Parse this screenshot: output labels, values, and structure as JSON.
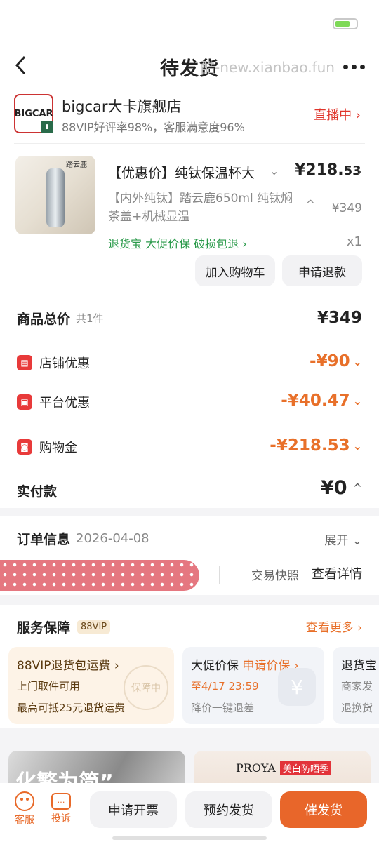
{
  "header": {
    "title": "待发货",
    "watermark": "酷-new.xianbao.fun"
  },
  "shop": {
    "logo": "BIGCAR",
    "name": "bigcar大卡旗舰店",
    "stats": "88VIP好评率98%，客服满意度96%",
    "live": "直播中 ›"
  },
  "product": {
    "image_brand": "踏云鹿",
    "name": "【优惠价】纯钛保温杯大",
    "price_int": "¥218.",
    "price_dec": "53",
    "desc": "【内外纯钛】踏云鹿650ml 纯钛焖茶盖+机械显温",
    "orig_price": "¥349",
    "guarantees": "退货宝  大促价保  破损包退 ›",
    "qty": "x1",
    "btn_cart": "加入购物车",
    "btn_refund": "申请退款"
  },
  "summary": {
    "total_label": "商品总价",
    "total_count": "共1件",
    "total_value": "¥349",
    "shop_label": "店铺优惠",
    "shop_value": "-¥90",
    "platform_label": "平台优惠",
    "platform_value": "-¥40.47",
    "gold_label": "购物金",
    "gold_value": "-¥218.53",
    "paid_label": "实付款",
    "paid_value": "¥0"
  },
  "order": {
    "label": "订单信息",
    "date": "2026-04-08",
    "expand": "展开",
    "snapshot": "交易快照",
    "detail": "查看详情"
  },
  "service": {
    "label": "服务保障",
    "badge": "88VIP",
    "more": "查看更多 ›",
    "boxes": [
      {
        "title": "88VIP退货包运费 ›",
        "line1": "上门取件可用",
        "line2": "最高可抵25元退货运费",
        "stamp": "保障中"
      },
      {
        "title": "大促价保",
        "link": "申请价保 ›",
        "line1": "至4/17 23:59",
        "line2": "降价一键退差"
      },
      {
        "title": "退货宝",
        "line1": "商家发",
        "line2": "退换货"
      }
    ]
  },
  "ads": {
    "left": "化繁为简”",
    "right_brand": "PROYA",
    "right_tag": "美白防晒季"
  },
  "bottom": {
    "service": "客服",
    "complain": "投诉",
    "invoice": "申请开票",
    "schedule": "预约发货",
    "urge": "催发货"
  },
  "colors": {
    "orange": "#e8702a",
    "red": "#e0352b",
    "green": "#2a9a4a",
    "accent_btn": "#e8662a"
  }
}
